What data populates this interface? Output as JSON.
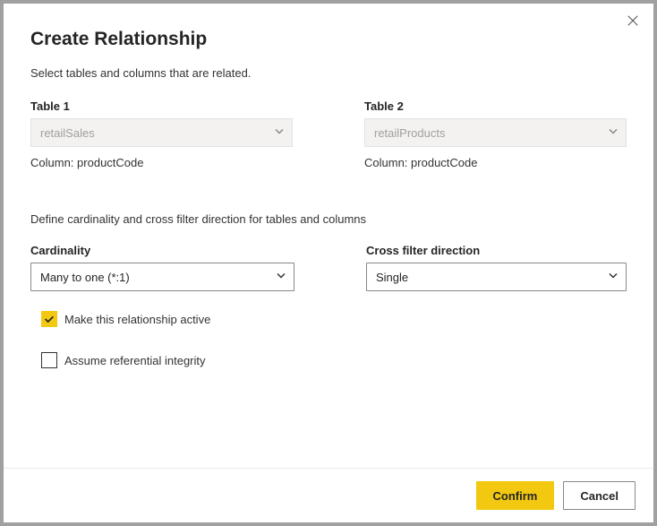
{
  "title": "Create Relationship",
  "subtitle": "Select tables and columns that are related.",
  "table1": {
    "label": "Table 1",
    "value": "retailSales",
    "column_prefix": "Column:",
    "column_value": "productCode"
  },
  "table2": {
    "label": "Table 2",
    "value": "retailProducts",
    "column_prefix": "Column:",
    "column_value": "productCode"
  },
  "section_text": "Define cardinality and cross filter direction for tables and columns",
  "cardinality": {
    "label": "Cardinality",
    "value": "Many to one (*:1)"
  },
  "cross_filter": {
    "label": "Cross filter direction",
    "value": "Single"
  },
  "checkbox_active": {
    "label": "Make this relationship active",
    "checked": true
  },
  "checkbox_integrity": {
    "label": "Assume referential integrity",
    "checked": false
  },
  "buttons": {
    "confirm": "Confirm",
    "cancel": "Cancel"
  }
}
